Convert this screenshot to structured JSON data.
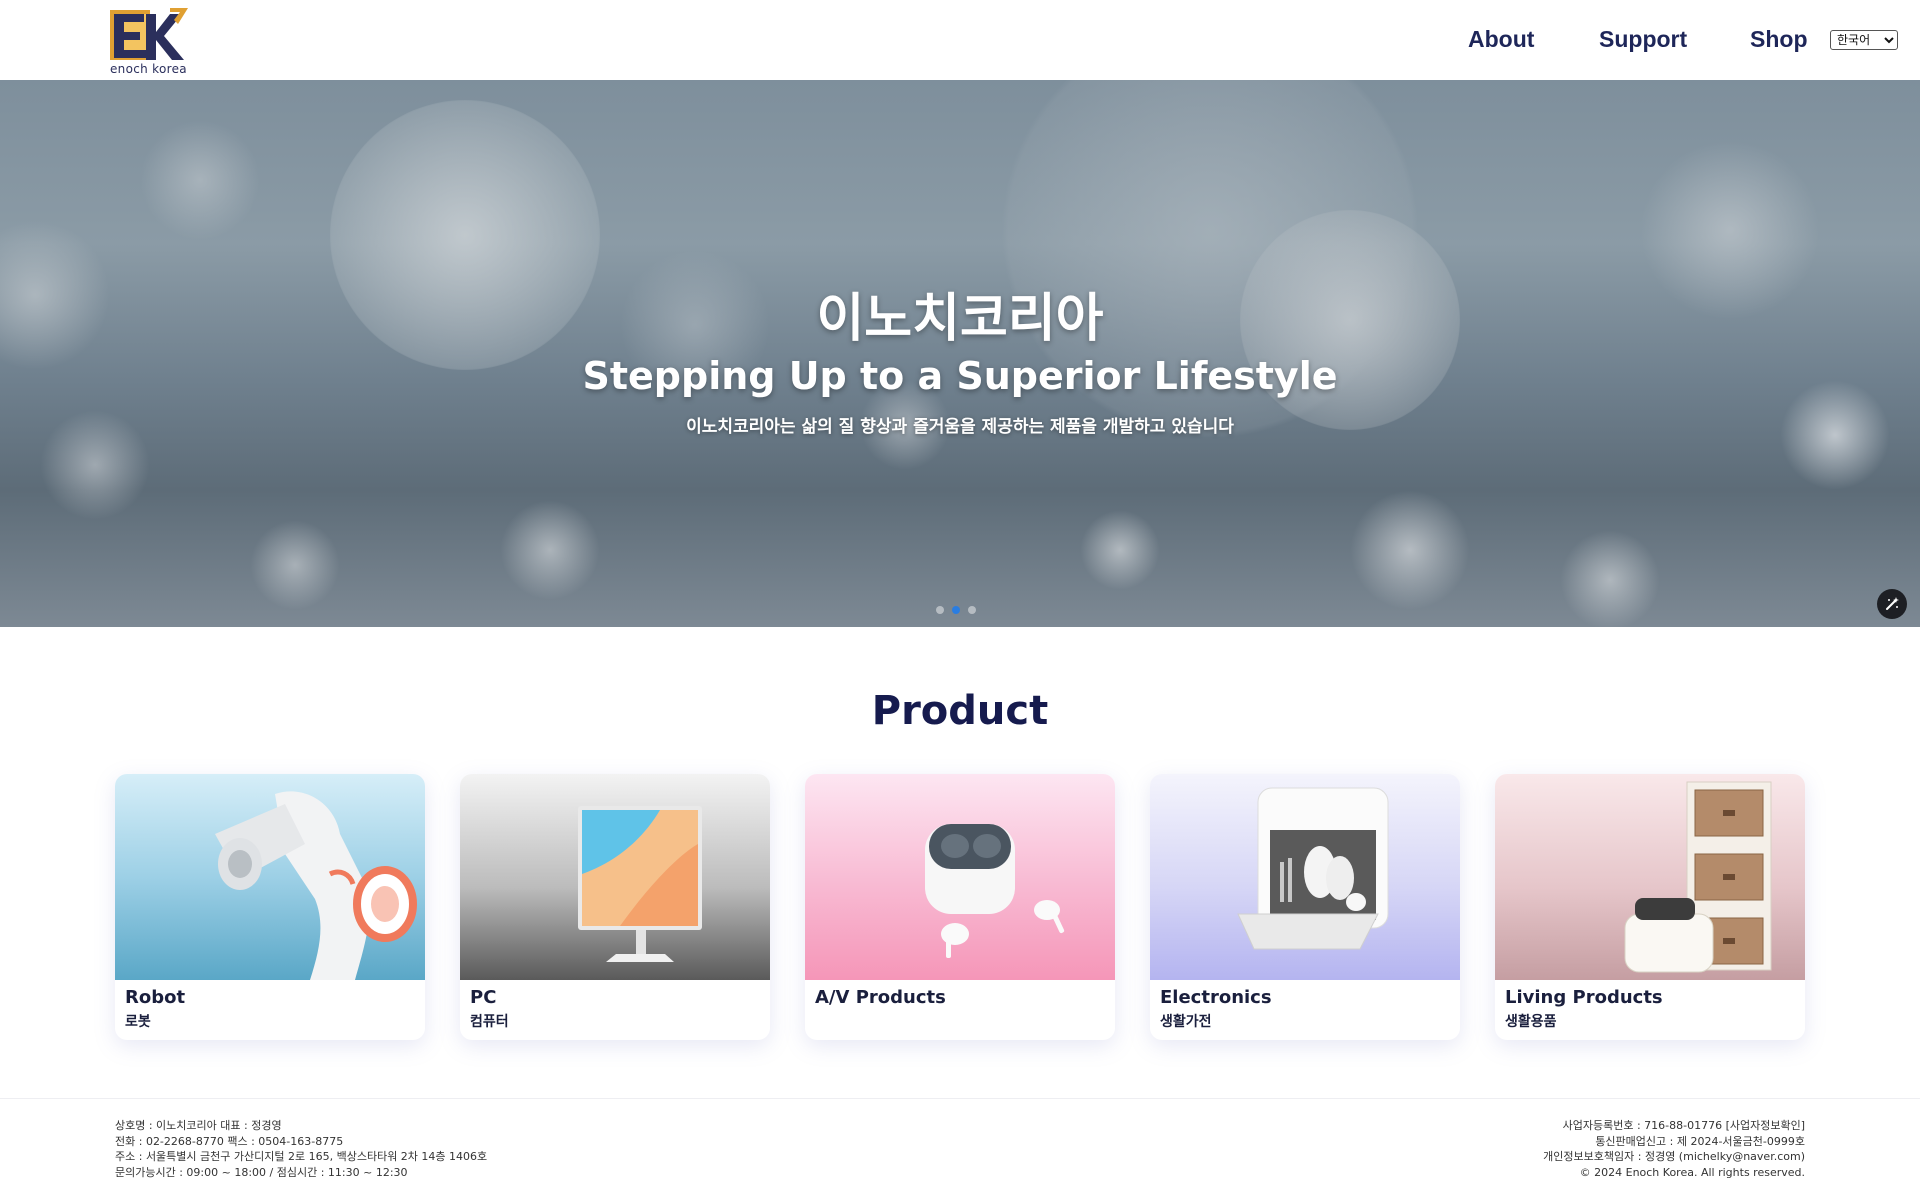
{
  "header": {
    "logo_text": "enoch korea",
    "nav": [
      "About",
      "Support",
      "Shop"
    ],
    "language": "한국어"
  },
  "hero": {
    "title": "이노치코리아",
    "subtitle": "Stepping Up to a Superior Lifestyle",
    "description": "이노치코리아는 삶의 질 향상과 즐거움을 제공하는 제품을 개발하고 있습니다",
    "slides_count": 3,
    "active_slide": 2
  },
  "product": {
    "title": "Product",
    "cards": [
      {
        "name": "Robot",
        "sub": "로봇"
      },
      {
        "name": "PC",
        "sub": "컴퓨터"
      },
      {
        "name": "A/V Products",
        "sub": ""
      },
      {
        "name": "Electronics",
        "sub": "생활가전"
      },
      {
        "name": "Living Products",
        "sub": "생활용품"
      }
    ]
  },
  "footer": {
    "left": [
      "상호명 : 이노치코리아 대표 : 정경영",
      "전화 : 02-2268-8770 팩스 : 0504-163-8775",
      "주소 : 서울특별시 금천구 가산디지털 2로 165, 백상스타타워 2차 14층 1406호",
      "문의가능시간 : 09:00 ~ 18:00 / 점심시간 : 11:30 ~ 12:30"
    ],
    "right": [
      "사업자등록번호 : 716-88-01776 [사업자정보확인]",
      "통신판매업신고 : 제 2024-서울금천-0999호",
      "개인정보보호책임자 : 정경영 (michelky@naver.com)",
      "© 2024 Enoch Korea. All rights reserved."
    ]
  },
  "colors": {
    "nav": "#1e2659",
    "title": "#161b4e",
    "dot_active": "#2a7de1",
    "logo_gold": "#e0a032",
    "logo_navy": "#2b2f5c"
  }
}
